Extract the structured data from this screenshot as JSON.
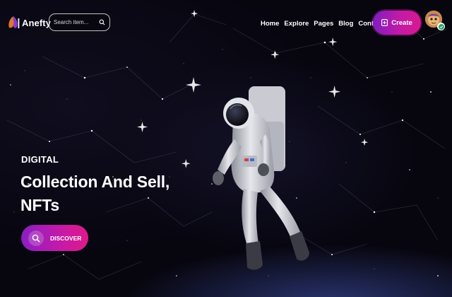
{
  "header": {
    "logo_text": "Anefty",
    "search_placeholder": "Search item...",
    "nav": [
      "Home",
      "Explore",
      "Pages",
      "Blog",
      "Contact"
    ],
    "create_label": "Create"
  },
  "hero": {
    "eyebrow": "DIGITAL",
    "headline_line1": "Collection And Sell,",
    "headline_line2": "NFTs",
    "discover_label": "DISCOVER"
  },
  "colors": {
    "background": "#07060f",
    "accent_start": "#7c1fbf",
    "accent_end": "#d9198f"
  },
  "icons": {
    "logo": "anefty-logo-icon",
    "search": "search-icon",
    "create": "create-icon",
    "discover": "discover-search-icon",
    "avatar": "user-avatar"
  }
}
